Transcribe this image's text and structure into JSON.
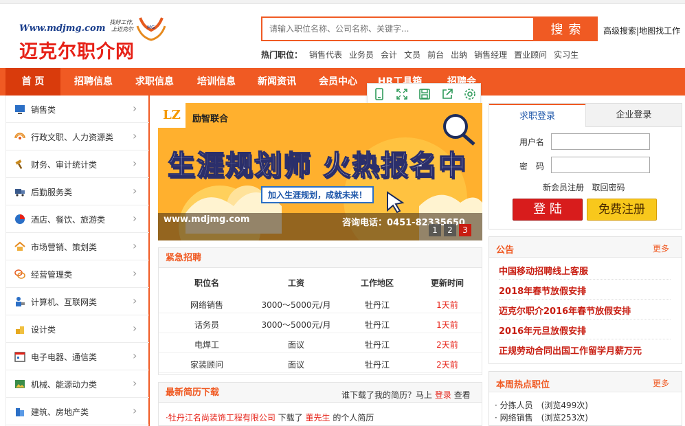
{
  "header": {
    "logo_url": "Www.mdjmg.com",
    "logo_slogan_1": "找好工作,",
    "logo_slogan_2": "上迈克尔",
    "logo_mark": "MG",
    "logo_name": "迈克尔职介网",
    "search_placeholder": "请输入职位名称、公司名称、关键字...",
    "search_button": "搜索",
    "advanced_search": "高级搜索",
    "map_search": "地图找工作",
    "hot_label": "热门职位：",
    "hot_jobs": [
      "销售代表",
      "业务员",
      "会计",
      "文员",
      "前台",
      "出纳",
      "销售经理",
      "置业顾问",
      "实习生"
    ]
  },
  "nav": {
    "items": [
      "首 页",
      "招聘信息",
      "求职信息",
      "培训信息",
      "新闻资讯",
      "会员中心",
      "HR工具箱",
      "招聘会"
    ]
  },
  "sidebar": {
    "items": [
      "销售类",
      "行政文职、人力资源类",
      "财务、审计统计类",
      "后勤服务类",
      "酒店、餐饮、旅游类",
      "市场营销、策划类",
      "经营管理类",
      "计算机、互联网类",
      "设计类",
      "电子电器、通信类",
      "机械、能源动力类",
      "建筑、房地产类"
    ]
  },
  "banner": {
    "logo": "LZ",
    "brand": "励智联合",
    "headline": "生涯规划师 火热报名中",
    "sub": "加入生涯规划，成就未来！",
    "url": "www.mdjmg.com",
    "phone": "咨询电话：0451-82335650",
    "slides": [
      "1",
      "2",
      "3"
    ],
    "active_slide": 3
  },
  "urgent": {
    "title": "紧急招聘",
    "headers": [
      "职位名",
      "工资",
      "工作地区",
      "更新时间"
    ],
    "rows": [
      [
        "网络销售",
        "3000～5000元/月",
        "牡丹江",
        "1天前"
      ],
      [
        "话务员",
        "3000～5000元/月",
        "牡丹江",
        "1天前"
      ],
      [
        "电焊工",
        "面议",
        "牡丹江",
        "2天前"
      ],
      [
        "家装顾问",
        "面议",
        "牡丹江",
        "2天前"
      ]
    ]
  },
  "resume": {
    "title": "最新简历下载",
    "ask": "谁下载了我的简历？马上",
    "login_link": "登录",
    "view": "查看",
    "entry_company": "牡丹江名尚装饰工程有限公司",
    "entry_action": "下载了",
    "entry_person": "董先生",
    "entry_suffix": "的个人简历"
  },
  "login": {
    "tab_personal": "求职登录",
    "tab_company": "企业登录",
    "username_label": "用户名",
    "password_label": "密　码",
    "register_link": "新会员注册",
    "forgot_link": "取回密码",
    "login_button": "登 陆",
    "register_button": "免费注册"
  },
  "notices": {
    "title": "公告",
    "more": "更多",
    "items": [
      "中国移动招聘线上客服",
      "2018年春节放假安排",
      "迈克尔职介2016年春节放假安排",
      "2016年元旦放假安排",
      "正规劳动合同出国工作留学月薪万元"
    ]
  },
  "hot_week": {
    "title": "本周热点职位",
    "more": "更多",
    "items": [
      "分拣人员　(浏览499次)",
      "网络销售　(浏览253次)"
    ]
  },
  "colors": {
    "accent": "#f05a23",
    "red": "#e62117",
    "link_blue": "#1b54a8"
  }
}
